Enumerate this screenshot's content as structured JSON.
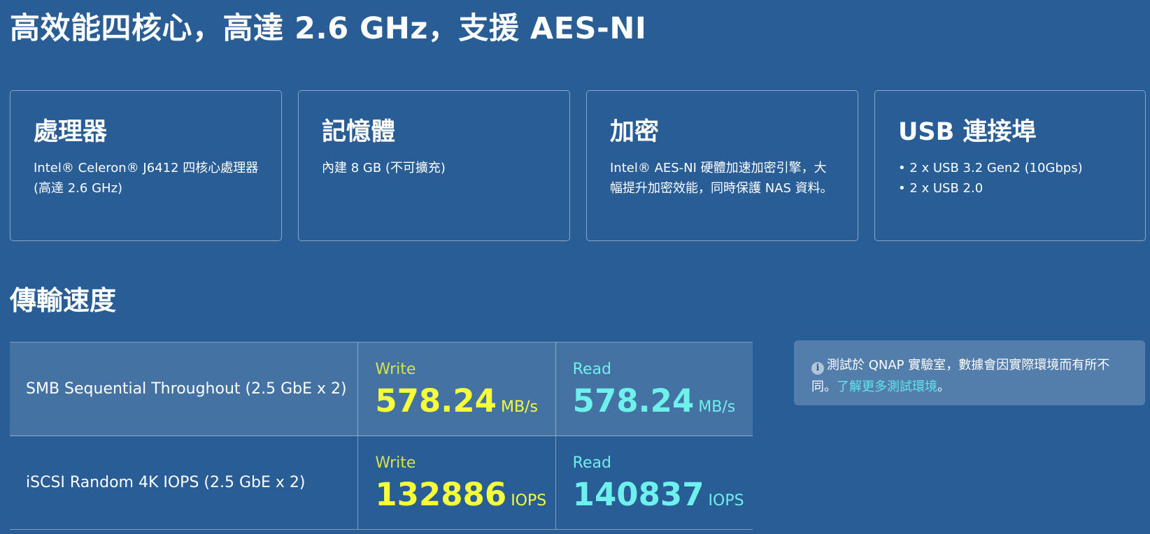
{
  "heading": "高效能四核心，高達 2.6 GHz，支援 AES-NI",
  "cards": [
    {
      "title": "處理器",
      "text": "Intel® Celeron® J6412 四核心處理器 (高達 2.6 GHz)"
    },
    {
      "title": "記憶體",
      "text": "內建 8 GB (不可擴充)"
    },
    {
      "title": "加密",
      "text": "Intel® AES-NI 硬體加速加密引擎，大幅提升加密效能，同時保護 NAS 資料。"
    },
    {
      "title": "USB 連接埠",
      "lines": [
        "• 2 x USB 3.2 Gen2 (10Gbps)",
        "• 2 x USB 2.0"
      ]
    }
  ],
  "transfer": {
    "title": "傳輸速度",
    "rows": [
      {
        "label": "SMB Sequential Throughout (2.5 GbE x 2)",
        "write": {
          "caption": "Write",
          "value": "578.24",
          "unit": "MB/s"
        },
        "read": {
          "caption": "Read",
          "value": "578.24",
          "unit": "MB/s"
        }
      },
      {
        "label": "iSCSI Random 4K IOPS (2.5 GbE x 2)",
        "write": {
          "caption": "Write",
          "value": "132886",
          "unit": "IOPS"
        },
        "read": {
          "caption": "Read",
          "value": "140837",
          "unit": "IOPS"
        }
      }
    ]
  },
  "note": {
    "icon": "info-icon",
    "text": "測試於 QNAP 實驗室，數據會因實際環境而有所不同。",
    "link": "了解更多測試環境",
    "suffix": "。"
  },
  "colors": {
    "background": "#285d96",
    "write": "#f6ff3a",
    "read": "#6ef1ec",
    "link": "#5ee6ef"
  }
}
